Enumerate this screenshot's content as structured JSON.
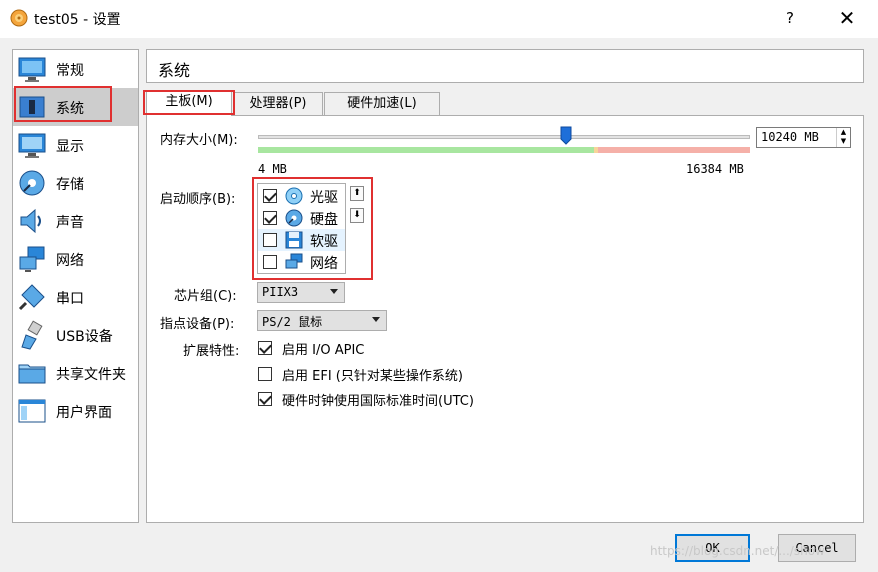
{
  "window": {
    "title": "test05 - 设置",
    "help": "?",
    "close": "✕"
  },
  "sidebar": {
    "items": [
      {
        "label": "常规",
        "icon": "monitor-icon"
      },
      {
        "label": "系统",
        "icon": "chip-icon"
      },
      {
        "label": "显示",
        "icon": "display-icon"
      },
      {
        "label": "存储",
        "icon": "disk-icon"
      },
      {
        "label": "声音",
        "icon": "speaker-icon"
      },
      {
        "label": "网络",
        "icon": "network-icon"
      },
      {
        "label": "串口",
        "icon": "serial-port-icon"
      },
      {
        "label": "USB设备",
        "icon": "usb-icon"
      },
      {
        "label": "共享文件夹",
        "icon": "folder-icon"
      },
      {
        "label": "用户界面",
        "icon": "window-icon"
      }
    ],
    "selected": "系统"
  },
  "section": {
    "title": "系统"
  },
  "tabs": [
    {
      "label": "主板(M)"
    },
    {
      "label": "处理器(P)"
    },
    {
      "label": "硬件加速(L)"
    }
  ],
  "motherboard": {
    "memory_label": "内存大小(M):",
    "memory_value": "10240 MB",
    "memory_min": "4 MB",
    "memory_max": "16384 MB",
    "memory_fraction": 0.625,
    "boot_order_label": "启动顺序(B):",
    "boot_items": [
      {
        "label": "光驱",
        "checked": true,
        "icon": "optical-disc-icon"
      },
      {
        "label": "硬盘",
        "checked": true,
        "icon": "hard-disk-icon"
      },
      {
        "label": "软驱",
        "checked": false,
        "icon": "floppy-icon"
      },
      {
        "label": "网络",
        "checked": false,
        "icon": "network-icon"
      }
    ],
    "chipset_label": "芯片组(C):",
    "chipset_value": "PIIX3",
    "pointing_label": "指点设备(P):",
    "pointing_value": "PS/2 鼠标",
    "features_label": "扩展特性:",
    "features": [
      {
        "label": "启用 I/O APIC",
        "checked": true
      },
      {
        "label": "启用 EFI (只针对某些操作系统)",
        "checked": false
      },
      {
        "label": "硬件时钟使用国际标准时间(UTC)",
        "checked": true
      }
    ]
  },
  "footer": {
    "ok": "OK",
    "cancel": "Cancel",
    "watermark": "https://blog.csdn.net/.../show"
  },
  "colors": {
    "highlight_red": "#e03030",
    "selection_gray": "#cdcdcd",
    "default_button_border": "#0078d7"
  }
}
